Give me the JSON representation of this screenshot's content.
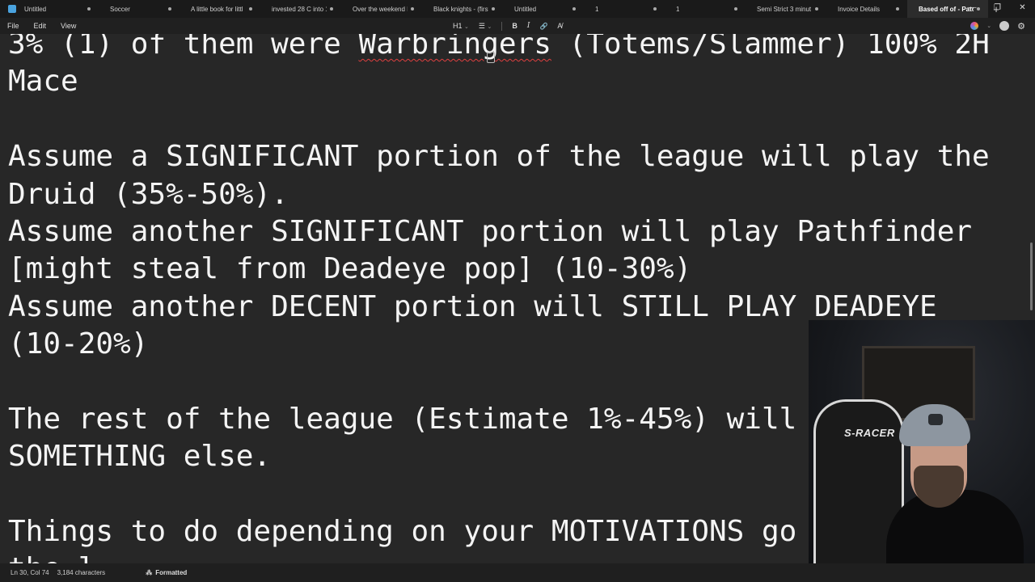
{
  "tabs": [
    {
      "label": "Untitled",
      "active": false
    },
    {
      "label": "Soccer",
      "active": false
    },
    {
      "label": "A little book for littl",
      "active": false
    },
    {
      "label": "invested 28 C into 1",
      "active": false
    },
    {
      "label": "Over the weekend I",
      "active": false
    },
    {
      "label": "Black knights - (first",
      "active": false
    },
    {
      "label": "Untitled",
      "active": false
    },
    {
      "label": "1",
      "active": false
    },
    {
      "label": "1",
      "active": false
    },
    {
      "label": "Semi Strict 3 minut",
      "active": false
    },
    {
      "label": "Invoice Details",
      "active": false
    },
    {
      "label": "Based off of - Patc",
      "active": true
    }
  ],
  "new_tab_label": "+",
  "window_controls": {
    "minimize": "—",
    "maximize": "❐",
    "close": "✕"
  },
  "menu": {
    "file": "File",
    "edit": "Edit",
    "view": "View"
  },
  "format_bar": {
    "heading": "H1",
    "heading_chevron": "⌄",
    "list": "☰",
    "list_chevron": "⌄",
    "bold": "B",
    "italic": "I",
    "link": "🔗",
    "clear": "A̸"
  },
  "right_icons": {
    "gear": "⚙"
  },
  "document": {
    "lines": [
      [
        "3% (1) of them were ",
        "Warbringers",
        " (Totems/Slammer) 100% 2H"
      ],
      [
        "Mace"
      ],
      [
        ""
      ],
      [
        "Assume a SIGNIFICANT portion of the league will play the"
      ],
      [
        "Druid (35%-50%)."
      ],
      [
        "Assume another SIGNIFICANT portion will play Pathfinder"
      ],
      [
        "[might steal from Deadeye pop] (10-30%)"
      ],
      [
        "Assume another DECENT portion will STILL PLAY DEADEYE"
      ],
      [
        "(10-20%)"
      ],
      [
        ""
      ],
      [
        "The rest of the league (Estimate 1%-45%) will"
      ],
      [
        "SOMETHING else."
      ],
      [
        ""
      ],
      [
        "Things to do depending on your MOTIVATIONS go"
      ],
      [
        "the l"
      ]
    ]
  },
  "webcam": {
    "chair_text": "S-RACER"
  },
  "status": {
    "position": "Ln 30, Col 74",
    "characters": "3,184 characters",
    "format_icon": "⁂",
    "format_label": "Formatted"
  },
  "colors": {
    "background": "#272727",
    "text": "#f4f4f4",
    "misspell_underline": "#e04040"
  }
}
